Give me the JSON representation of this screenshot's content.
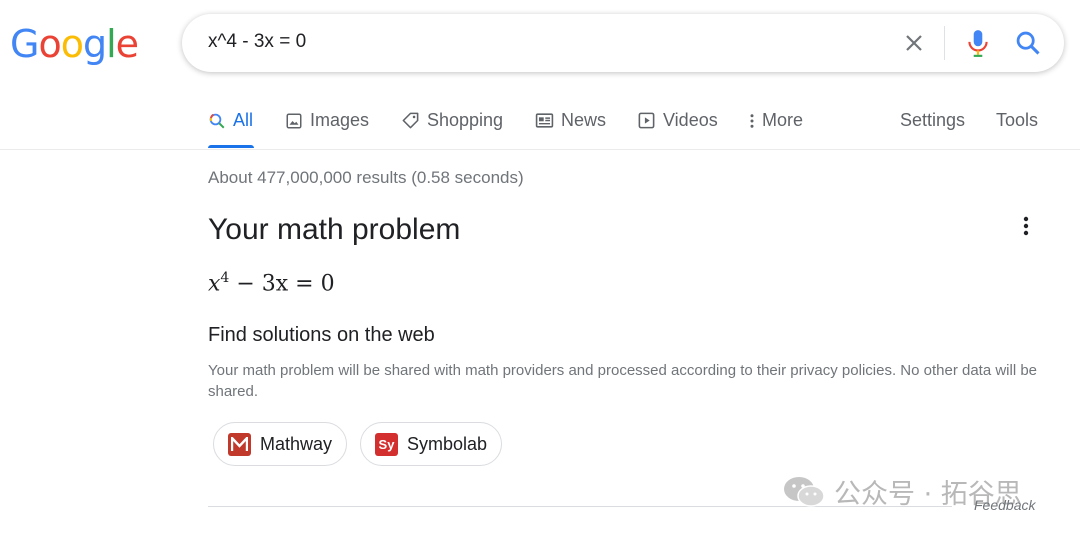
{
  "logo": {
    "letters": [
      "G",
      "o",
      "o",
      "g",
      "l",
      "e"
    ],
    "colors": [
      "#4285F4",
      "#EA4335",
      "#FBBC05",
      "#4285F4",
      "#34A853",
      "#EA4335"
    ]
  },
  "search": {
    "query": "x^4 - 3x = 0"
  },
  "tabs": [
    {
      "label": "All",
      "icon": "search-icon",
      "active": true
    },
    {
      "label": "Images",
      "icon": "image-icon"
    },
    {
      "label": "Shopping",
      "icon": "tag-icon"
    },
    {
      "label": "News",
      "icon": "newspaper-icon"
    },
    {
      "label": "Videos",
      "icon": "play-icon"
    },
    {
      "label": "More",
      "icon": "kebab-icon"
    }
  ],
  "tools": {
    "settings": "Settings",
    "tools": "Tools"
  },
  "stats": "About 477,000,000 results (0.58 seconds)",
  "card": {
    "title": "Your math problem",
    "equation": {
      "var": "x",
      "exponent": "4",
      "rest": " − 3x = 0"
    },
    "find_title": "Find solutions on the web",
    "disclaimer": "Your math problem will be shared with math providers and processed according to their privacy policies. No other data will be shared.",
    "providers": [
      {
        "label": "Mathway",
        "icon": "mathway-logo",
        "color": "#c0392b"
      },
      {
        "label": "Symbolab",
        "icon": "symbolab-logo",
        "color": "#d32f2f",
        "glyph": "Sy"
      }
    ]
  },
  "feedback": "Feedback",
  "watermark": "公众号 · 拓谷思",
  "colors": {
    "accent": "#1a73e8",
    "secondary_text": "#70757a"
  }
}
